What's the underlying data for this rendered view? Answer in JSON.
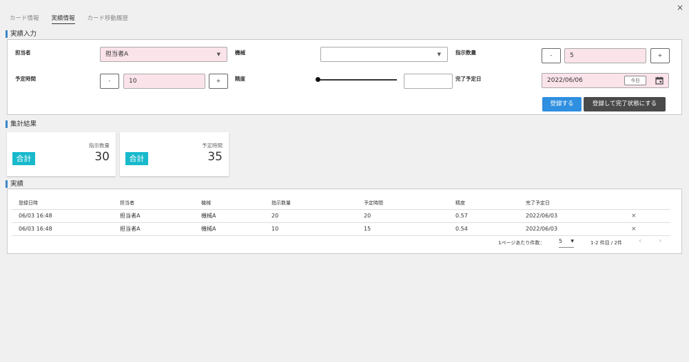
{
  "tabs": [
    "カード情報",
    "実績情報",
    "カード移動履歴"
  ],
  "input_section": {
    "title": "実績入力",
    "assignee_label": "担当者",
    "assignee_value": "担当者A",
    "machine_label": "機械",
    "machine_value": "",
    "qty_label": "指示数量",
    "qty_value": "5",
    "plan_time_label": "予定時間",
    "plan_time_value": "10",
    "accuracy_label": "精度",
    "accuracy_value": "",
    "due_label": "完了予定日",
    "due_value": "2022/06/06",
    "today_label": "今日",
    "minus": "-",
    "plus": "+",
    "register_label": "登録する",
    "register_complete_label": "登録して完了状態にする"
  },
  "summary_section": {
    "title": "集計結果",
    "cards": [
      {
        "badge": "合計",
        "label": "指示数量",
        "value": "30"
      },
      {
        "badge": "合計",
        "label": "予定時間",
        "value": "35"
      }
    ]
  },
  "results_section": {
    "title": "実績",
    "columns": [
      "登録日時",
      "担当者",
      "機械",
      "指示数量",
      "予定時間",
      "精度",
      "完了予定日",
      ""
    ],
    "rows": [
      [
        "06/03 16:48",
        "担当者A",
        "機械A",
        "20",
        "20",
        "0.57",
        "2022/06/03",
        "×"
      ],
      [
        "06/03 16:48",
        "担当者A",
        "機械A",
        "10",
        "15",
        "0.54",
        "2022/06/03",
        "×"
      ]
    ],
    "per_page_label": "1ページあたり件数：",
    "per_page_value": "5",
    "range_label": "1-2 件目 / 2件",
    "prev": "‹",
    "next": "›"
  },
  "close": "×",
  "colors": {
    "accent": "#3a86c8",
    "primary": "#2f8fe0",
    "badge": "#19b9cc",
    "pink": "#fbe3ea"
  }
}
